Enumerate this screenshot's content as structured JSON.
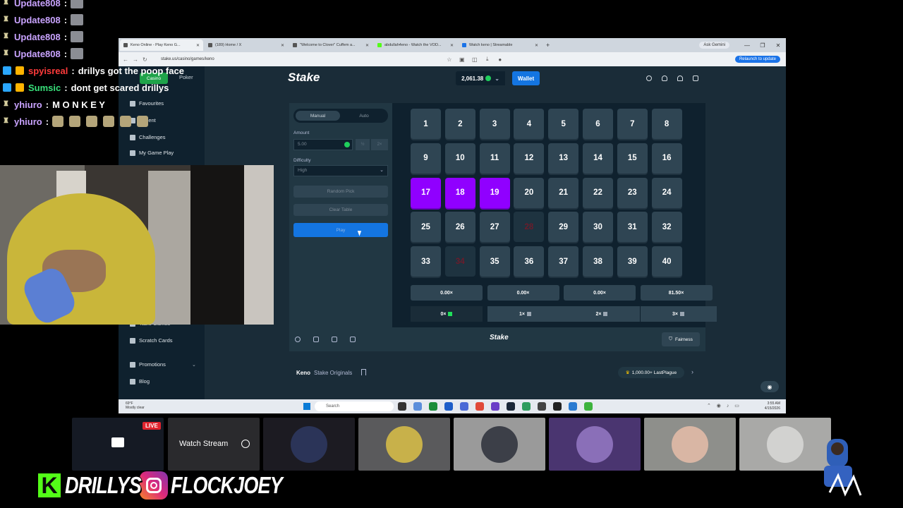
{
  "chat": [
    {
      "user": "Update808",
      "color": "#c9a3ff",
      "badge": "trophy",
      "kind": "avatar"
    },
    {
      "user": "Update808",
      "color": "#c9a3ff",
      "badge": "trophy",
      "kind": "avatar"
    },
    {
      "user": "Update808",
      "color": "#c9a3ff",
      "badge": "trophy",
      "kind": "avatar"
    },
    {
      "user": "Update808",
      "color": "#c9a3ff",
      "badge": "trophy",
      "kind": "avatar"
    },
    {
      "user": "spyisreal",
      "color": "#ff3b3b",
      "badge": "sub",
      "message": "drillys got the poop face"
    },
    {
      "user": "Sumsic",
      "color": "#38e07a",
      "badge": "sub",
      "message": "dont get scared drillys"
    },
    {
      "user": "yhiuro",
      "color": "#c9a3ff",
      "badge": "trophy",
      "message": "M O N K E Y"
    },
    {
      "user": "yhiuro",
      "color": "#c9a3ff",
      "badge": "trophy",
      "kind": "emotes"
    }
  ],
  "browser": {
    "tabs": [
      "Keno Online - Play Keno G...",
      "(189) Home / X",
      "\"Welcome to Clover\" Cuffem a...",
      "abdullah4eno - Watch the VOD...",
      "Watch keno | Streamable"
    ],
    "new_tab": "+",
    "ask_gemini": "Ask Gemini",
    "url": "stake.us/casino/games/keno",
    "relaunch": "Relaunch to update"
  },
  "stake": {
    "logo": "Stake",
    "balance": "2,061.38",
    "wallet": "Wallet",
    "sidebar": {
      "casino": "Casino",
      "poker": "Poker",
      "items": [
        "Favourites",
        "Recent",
        "Challenges",
        "My Game Play",
        "Table Games",
        "Scratch Cards",
        "Promotions",
        "Blog"
      ]
    },
    "controls": {
      "manual": "Manual",
      "auto": "Auto",
      "amount_label": "Amount",
      "amount_value": "5.00",
      "half": "½",
      "double": "2×",
      "difficulty_label": "Difficulty",
      "difficulty_value": "High",
      "random_pick": "Random Pick",
      "clear_table": "Clear Table",
      "play": "Play"
    },
    "tiles": [
      {
        "n": "1",
        "s": ""
      },
      {
        "n": "2",
        "s": ""
      },
      {
        "n": "3",
        "s": ""
      },
      {
        "n": "4",
        "s": ""
      },
      {
        "n": "5",
        "s": ""
      },
      {
        "n": "6",
        "s": ""
      },
      {
        "n": "7",
        "s": ""
      },
      {
        "n": "8",
        "s": ""
      },
      {
        "n": "9",
        "s": ""
      },
      {
        "n": "10",
        "s": ""
      },
      {
        "n": "11",
        "s": ""
      },
      {
        "n": "12",
        "s": ""
      },
      {
        "n": "13",
        "s": ""
      },
      {
        "n": "14",
        "s": ""
      },
      {
        "n": "15",
        "s": ""
      },
      {
        "n": "16",
        "s": ""
      },
      {
        "n": "17",
        "s": "selected"
      },
      {
        "n": "18",
        "s": "selected"
      },
      {
        "n": "19",
        "s": "selected"
      },
      {
        "n": "20",
        "s": ""
      },
      {
        "n": "21",
        "s": ""
      },
      {
        "n": "22",
        "s": ""
      },
      {
        "n": "23",
        "s": ""
      },
      {
        "n": "24",
        "s": ""
      },
      {
        "n": "25",
        "s": ""
      },
      {
        "n": "26",
        "s": ""
      },
      {
        "n": "27",
        "s": ""
      },
      {
        "n": "28",
        "s": "hit"
      },
      {
        "n": "29",
        "s": ""
      },
      {
        "n": "30",
        "s": ""
      },
      {
        "n": "31",
        "s": ""
      },
      {
        "n": "32",
        "s": ""
      },
      {
        "n": "33",
        "s": ""
      },
      {
        "n": "34",
        "s": "hit"
      },
      {
        "n": "35",
        "s": ""
      },
      {
        "n": "36",
        "s": ""
      },
      {
        "n": "37",
        "s": ""
      },
      {
        "n": "38",
        "s": ""
      },
      {
        "n": "39",
        "s": ""
      },
      {
        "n": "40",
        "s": ""
      }
    ],
    "multipliers": [
      "0.00×",
      "0.00×",
      "0.00×",
      "81.50×"
    ],
    "hits": [
      "0×",
      "1×",
      "2×",
      "3×"
    ],
    "footer_logo": "Stake",
    "fairness": "Fairness",
    "game_title": "Keno",
    "game_sub": "Stake Originals",
    "leader": "1,000.00+ LastPlague"
  },
  "taskbar": {
    "weather_temp": "69°F",
    "weather_desc": "Mostly clear",
    "search": "Search",
    "time": "3:55 AM",
    "date": "4/15/2026"
  },
  "stream": {
    "live": "LIVE",
    "watch_stream": "Watch Stream",
    "kick_letter": "K",
    "kick_name": "DRILLYS",
    "ig_name": "FLOCKJOEY"
  }
}
